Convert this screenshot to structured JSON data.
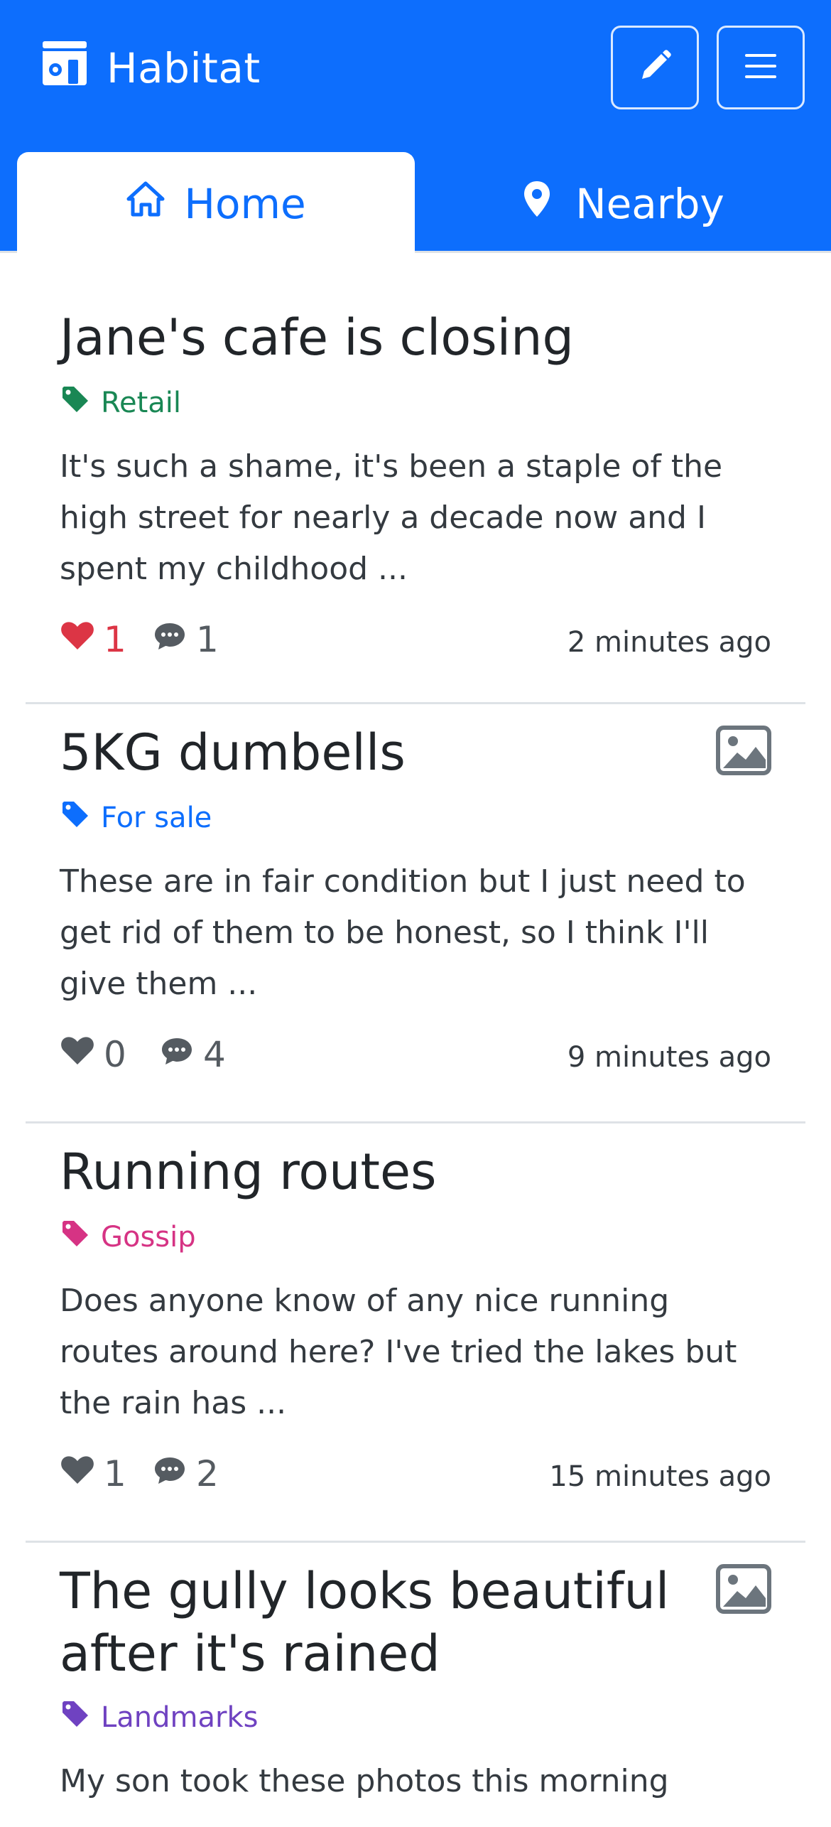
{
  "app": {
    "title": "Habitat",
    "accent": "#0d6efd"
  },
  "navbar": {
    "edit_icon": "pencil-icon",
    "menu_icon": "hamburger-icon"
  },
  "tabs": [
    {
      "label": "Home",
      "icon": "house-icon",
      "active": true
    },
    {
      "label": "Nearby",
      "icon": "map-pin-icon",
      "active": false
    }
  ],
  "posts": [
    {
      "title": "Jane's cafe is closing",
      "tag": "Retail",
      "tag_color": "#198754",
      "excerpt": "It's such a shame, it's been a staple of the high street for nearly a decade now and I spent my childhood ...",
      "likes": "1",
      "liked": true,
      "comments": "1",
      "time": "2 minutes ago",
      "has_image": false
    },
    {
      "title": "5KG dumbells",
      "tag": "For sale",
      "tag_color": "#0d6efd",
      "excerpt": "These are in fair condition but I just need to get rid of them to be honest, so I think I'll give them ...",
      "likes": "0",
      "liked": false,
      "comments": "4",
      "time": "9 minutes ago",
      "has_image": true
    },
    {
      "title": "Running routes",
      "tag": "Gossip",
      "tag_color": "#d63384",
      "excerpt": "Does anyone know of any nice running routes around here? I've tried the lakes but the rain has ...",
      "likes": "1",
      "liked": false,
      "comments": "2",
      "time": "15 minutes ago",
      "has_image": false
    },
    {
      "title": "The gully looks beautiful after it's rained",
      "tag": "Landmarks",
      "tag_color": "#6f42c1",
      "excerpt": "My son took these photos this morning",
      "has_image": true
    }
  ]
}
